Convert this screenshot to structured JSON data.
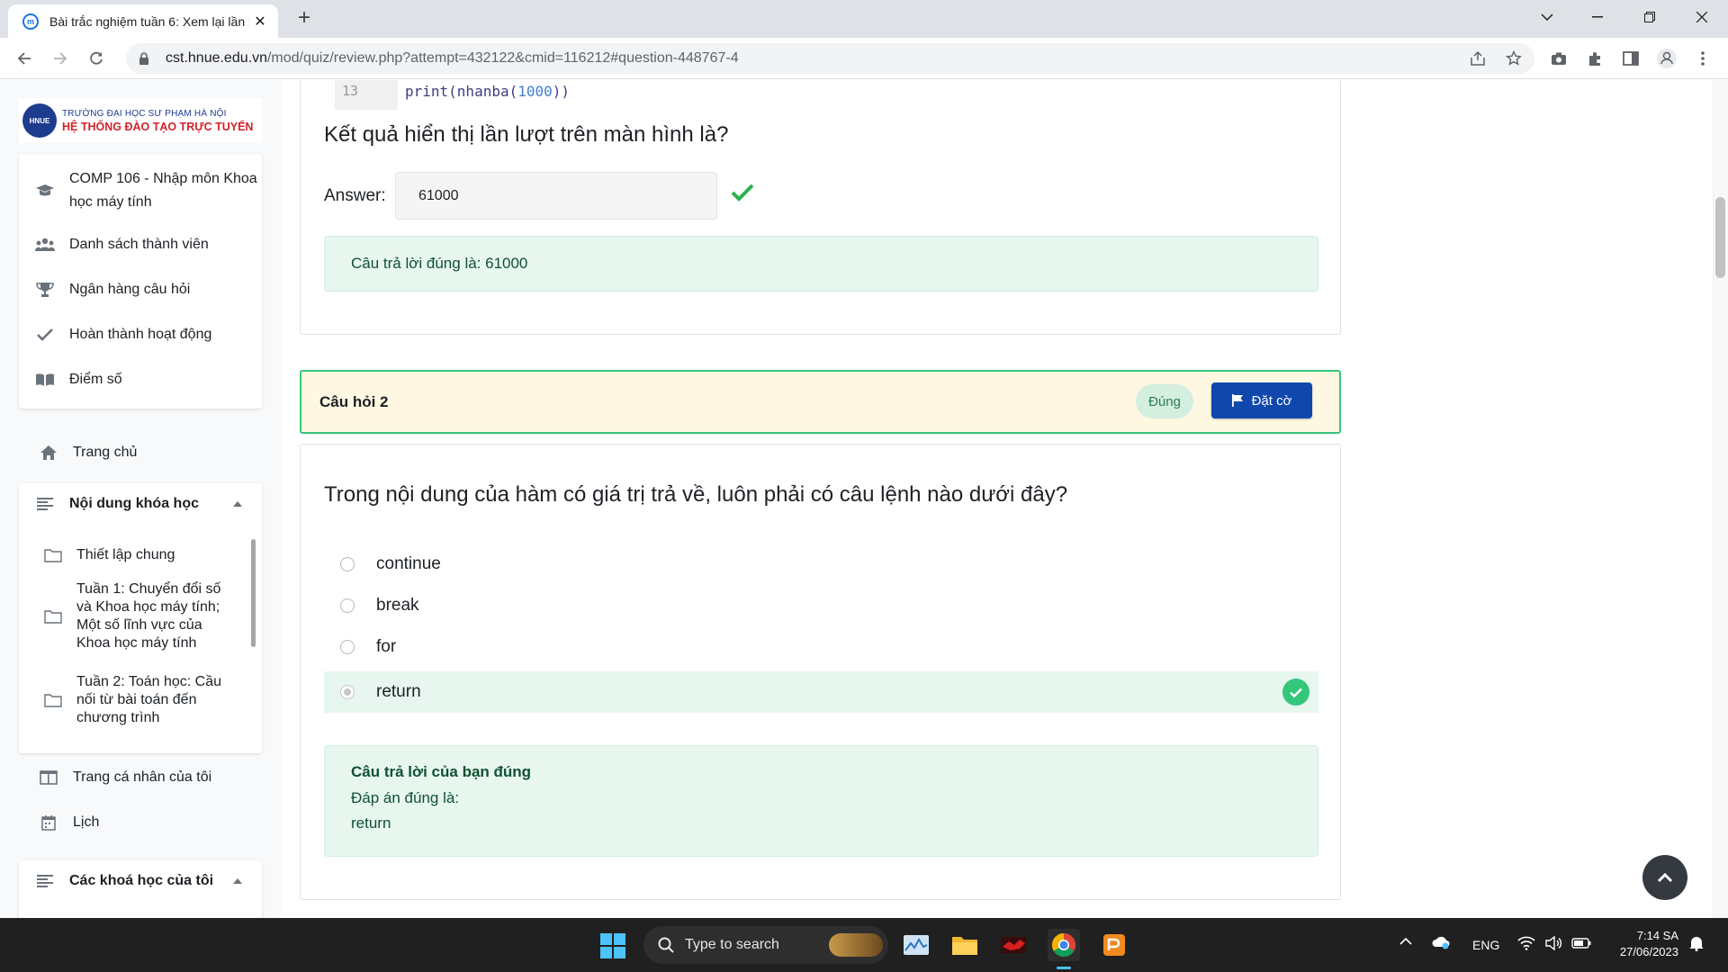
{
  "browser": {
    "tab_title": "Bài trắc nghiệm tuần 6: Xem lại lần làm bài",
    "url_host": "cst.hnue.edu.vn",
    "url_path": "/mod/quiz/review.php?attempt=432122&cmid=116212#question-448767-4"
  },
  "logo": {
    "line1": "TRƯỜNG ĐẠI HỌC SƯ PHẠM HÀ NỘI",
    "line2": "HỆ THỐNG ĐÀO TẠO TRỰC TUYẾN",
    "mark": "HNUE"
  },
  "sidebar": {
    "course_nav": [
      {
        "label": "COMP 106 - Nhập môn Khoa học máy tính",
        "icon": "graduation-cap-icon"
      },
      {
        "label": "Danh sách thành viên",
        "icon": "users-icon"
      },
      {
        "label": "Ngân hàng câu hỏi",
        "icon": "trophy-icon"
      },
      {
        "label": "Hoàn thành hoạt động",
        "icon": "check-icon"
      },
      {
        "label": "Điểm số",
        "icon": "book-icon"
      }
    ],
    "home": "Trang chủ",
    "course_content_title": "Nội dung khóa học",
    "course_sections": [
      "Thiết lập chung",
      "Tuần 1: Chuyển đổi số và Khoa học máy tính; Một số lĩnh vực của Khoa học máy tính",
      "Tuần 2: Toán học: Cầu nối từ bài toán đến chương trình"
    ],
    "profile": "Trang cá nhân của tôi",
    "calendar": "Lịch",
    "my_courses_title": "Các khoá học của tôi"
  },
  "question1": {
    "code_line_number": "13",
    "code_prefix": "print(nhanba(",
    "code_number": "1000",
    "code_suffix": "))",
    "prompt": "Kết quả hiển thị lần lượt trên màn hình là?",
    "answer_label": "Answer:",
    "answer_value": "61000",
    "feedback": "Câu trả lời đúng là: 61000"
  },
  "question2": {
    "title": "Câu hỏi 2",
    "status": "Đúng",
    "flag_label": "Đặt cờ",
    "prompt": "Trong nội dung của hàm có giá trị trả về, luôn phải có câu lệnh nào dưới đây?",
    "options": [
      {
        "label": "continue",
        "selected": false
      },
      {
        "label": "break",
        "selected": false
      },
      {
        "label": "for",
        "selected": false
      },
      {
        "label": "return",
        "selected": true
      }
    ],
    "feedback_title": "Câu trả lời của bạn đúng",
    "feedback_line": "Đáp án đúng là:",
    "feedback_answer": "return"
  },
  "taskbar": {
    "search_placeholder": "Type to search",
    "language": "ENG",
    "time": "7:14 SA",
    "date": "27/06/2023"
  },
  "colors": {
    "correct_green": "#34c77b",
    "feedback_bg": "#e7f6ef",
    "flag_button": "#0f47ad",
    "header_bg": "#fef7e1",
    "brand_red": "#d3222a",
    "brand_blue": "#1d3c8f"
  }
}
